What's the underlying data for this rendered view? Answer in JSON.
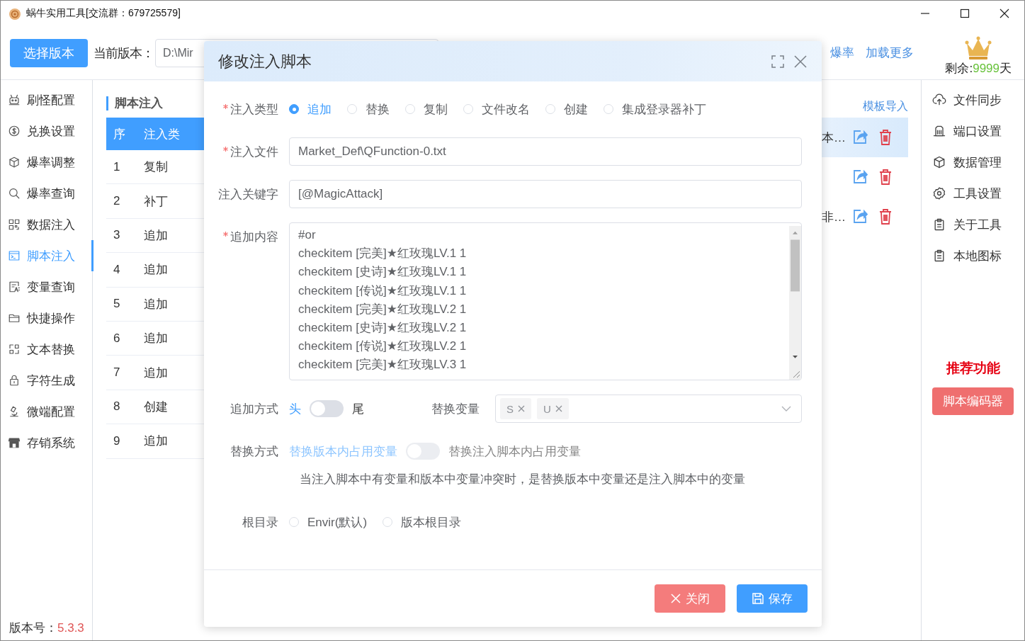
{
  "window": {
    "title": "蜗牛实用工具[交流群：679725579]"
  },
  "toolbar": {
    "select_button": "选择版本",
    "current_label": "当前版本：",
    "current_path": "D:\\Mir",
    "links": [
      "爆率",
      "加载更多"
    ],
    "remaining": {
      "label": "剩余:",
      "value": "9999",
      "unit": "天"
    }
  },
  "sidebar": {
    "items": [
      {
        "label": "刷怪配置",
        "selected": false
      },
      {
        "label": "兑换设置",
        "selected": false
      },
      {
        "label": "爆率调整",
        "selected": false
      },
      {
        "label": "爆率查询",
        "selected": false
      },
      {
        "label": "数据注入",
        "selected": false
      },
      {
        "label": "脚本注入",
        "selected": true
      },
      {
        "label": "变量查询",
        "selected": false
      },
      {
        "label": "快捷操作",
        "selected": false
      },
      {
        "label": "文本替换",
        "selected": false
      },
      {
        "label": "字符生成",
        "selected": false
      },
      {
        "label": "微端配置",
        "selected": false
      },
      {
        "label": "存销系统",
        "selected": false
      }
    ],
    "version_label": "版本号：",
    "version": "5.3.3"
  },
  "main": {
    "title": "脚本注入",
    "import_link": "模板导入",
    "table": {
      "columns": [
        "序",
        "注入类"
      ],
      "rows": [
        {
          "index": "1",
          "type": "复制"
        },
        {
          "index": "2",
          "type": "补丁"
        },
        {
          "index": "3",
          "type": "追加"
        },
        {
          "index": "4",
          "type": "追加"
        },
        {
          "index": "5",
          "type": "追加"
        },
        {
          "index": "6",
          "type": "追加"
        },
        {
          "index": "7",
          "type": "追加"
        },
        {
          "index": "8",
          "type": "创建"
        },
        {
          "index": "9",
          "type": "追加"
        }
      ]
    },
    "right_rows": [
      {
        "text": "本…",
        "selected": true
      },
      {
        "selected": false
      },
      {
        "text": "非…",
        "selected": false
      }
    ]
  },
  "right_sidebar": {
    "items": [
      "文件同步",
      "端口设置",
      "数据管理",
      "工具设置",
      "关于工具",
      "本地图标"
    ],
    "recommend_title": "推荐功能",
    "recommend_button": "脚本编码器"
  },
  "dialog": {
    "title": "修改注入脚本",
    "inject_type": {
      "label": "注入类型",
      "required": true,
      "options": [
        {
          "label": "追加",
          "selected": true
        },
        {
          "label": "替换",
          "selected": false
        },
        {
          "label": "复制",
          "selected": false
        },
        {
          "label": "文件改名",
          "selected": false
        },
        {
          "label": "创建",
          "selected": false
        },
        {
          "label": "集成登录器补丁",
          "selected": false
        }
      ]
    },
    "inject_file": {
      "label": "注入文件",
      "required": true,
      "value": "Market_Def\\QFunction-0.txt"
    },
    "keyword": {
      "label": "注入关键字",
      "required": false,
      "value": "[@MagicAttack]"
    },
    "content": {
      "label": "追加内容",
      "required": true,
      "lines": [
        "#or",
        "checkitem [完美]★红玫瑰LV.1 1",
        "checkitem [史诗]★红玫瑰LV.1 1",
        "checkitem [传说]★红玫瑰LV.1 1",
        "checkitem [完美]★红玫瑰LV.2 1",
        "checkitem [史诗]★红玫瑰LV.2 1",
        "checkitem [传说]★红玫瑰LV.2 1",
        "checkitem [完美]★红玫瑰LV.3 1"
      ]
    },
    "append_mode": {
      "label": "追加方式",
      "off_label": "头",
      "on_label": "尾",
      "on": false,
      "disabled": false
    },
    "replace_vars": {
      "label": "替换变量",
      "tags": [
        "S",
        "U"
      ]
    },
    "replace_mode": {
      "label": "替换方式",
      "off_label": "替换版本内占用变量",
      "on_label": "替换注入脚本内占用变量",
      "on": false,
      "disabled": true
    },
    "hint": "当注入脚本中有变量和版本中变量冲突时，是替换版本中变量还是注入脚本中的变量",
    "root_dir": {
      "label": "根目录",
      "options": [
        {
          "label": "Envir(默认)",
          "selected": false
        },
        {
          "label": "版本根目录",
          "selected": false
        }
      ]
    },
    "buttons": [
      {
        "label": "关闭",
        "kind": "danger"
      },
      {
        "label": "保存",
        "kind": "primary"
      }
    ]
  }
}
